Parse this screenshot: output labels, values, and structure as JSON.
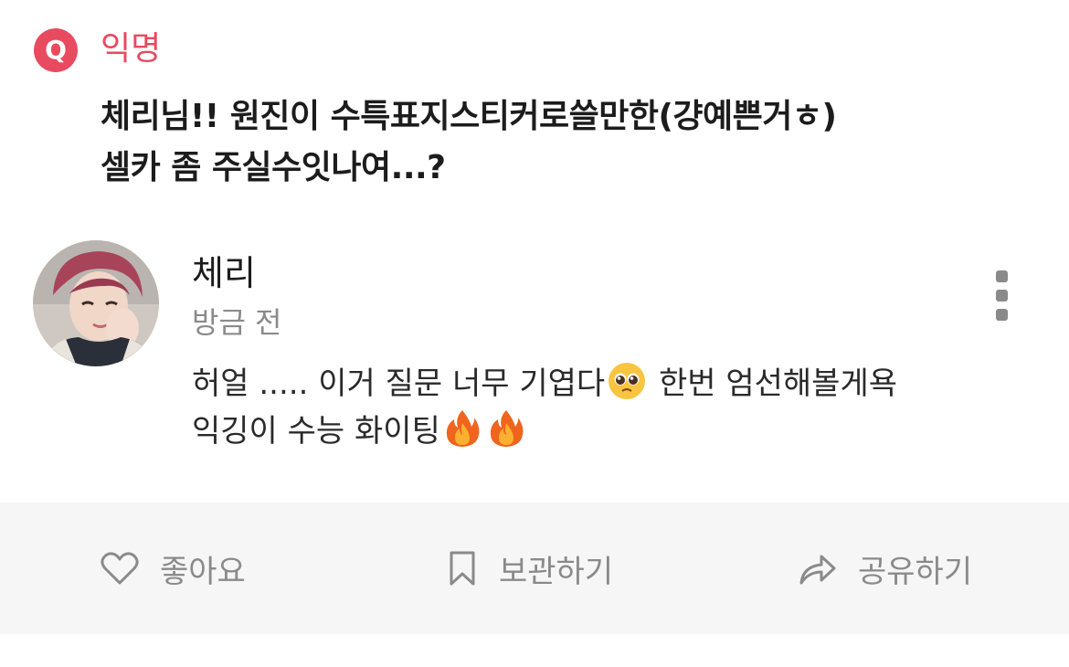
{
  "question": {
    "badge": "Q",
    "author": "익명",
    "lines": [
      "체리님!! 원진이 수특표지스티커로쓸만한(걍예쁜거ㅎ)",
      "셀카 좀 주실수잇나여...?"
    ]
  },
  "answer": {
    "name": "체리",
    "time": "방금 전",
    "line1_a": "허얼 ..... 이거 질문 너무 기엽다",
    "line1_b": " 한번 엄선해볼게욕",
    "line2": "익깅이 수능 화이팅"
  },
  "actions": {
    "like": "좋아요",
    "save": "보관하기",
    "share": "공유하기"
  },
  "colors": {
    "accent": "#e84a5f",
    "muted": "#8a8a8a",
    "action_bar_bg": "#f6f6f6"
  },
  "icons": {
    "q_badge": "q-badge-icon",
    "more": "more-vertical-icon",
    "emoji_1": "pleading-face-emoji",
    "emoji_2": "fire-emoji",
    "like": "heart-icon",
    "save": "bookmark-icon",
    "share": "share-arrow-icon"
  }
}
